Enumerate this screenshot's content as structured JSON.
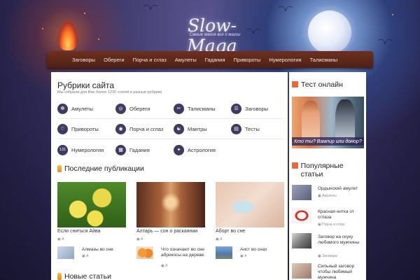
{
  "header": {
    "logo": "Slow-Maga",
    "slogan": "Самые магия все о магии"
  },
  "nav": {
    "items": [
      "Заговоры",
      "Обереги",
      "Порча и сглаз",
      "Амулеты",
      "Гадания",
      "Привороты",
      "Нумерология",
      "Талисманы"
    ]
  },
  "rubrics": {
    "title": "Рубрики сайта",
    "subtitle": "Мы собрали для Вас более 1230 статей в разные рубрики",
    "items": [
      {
        "label": "Амулеты",
        "icon": "amulet-icon",
        "glyph": "☸"
      },
      {
        "label": "Обереги",
        "icon": "ring-icon",
        "glyph": "◎"
      },
      {
        "label": "Талисманы",
        "icon": "talisman-icon",
        "glyph": "✂"
      },
      {
        "label": "Заговоры",
        "icon": "scroll-icon",
        "glyph": "☰"
      },
      {
        "label": "Привороты",
        "icon": "heart-icon",
        "glyph": "♡"
      },
      {
        "label": "Порча и сглаз",
        "icon": "eye-icon",
        "glyph": "◉"
      },
      {
        "label": "Мантры",
        "icon": "yin-yang-icon",
        "glyph": "☯"
      },
      {
        "label": "Тесты",
        "icon": "document-icon",
        "glyph": "▤"
      },
      {
        "label": "Нумерология",
        "icon": "number-icon",
        "glyph": "131"
      },
      {
        "label": "Гадания",
        "icon": "cards-icon",
        "glyph": "▦"
      },
      {
        "label": "Астрология",
        "icon": "star-icon",
        "glyph": "✦"
      }
    ]
  },
  "recent": {
    "title": "Последние публикации",
    "cards": [
      {
        "title": "Если сниться Айва",
        "meta": "А"
      },
      {
        "title": "Алтарь — сон о раскаянии",
        "meta": "А"
      },
      {
        "title": "Аборт во сне",
        "meta": "А"
      }
    ],
    "small": [
      {
        "title": "Алмазы во сне",
        "meta": "А"
      },
      {
        "title": "Что означают во сне абрикосы на дереве",
        "meta": "А"
      },
      {
        "title": "Аист во снах",
        "meta": "А"
      }
    ]
  },
  "new_section": {
    "title": "Новые статьи"
  },
  "sidebar": {
    "test_title": "Тест онлайн",
    "test_caption": "Кто ты? Вампир или донор?",
    "popular_title": "Популярные статьи",
    "popular": [
      {
        "title": "Ордынский амулет",
        "meta": "Амулеты"
      },
      {
        "title": "Красная нитка от сглаза",
        "meta": "Порча и сглаз"
      },
      {
        "title": "Заговор на скуку любимого мужчины",
        "meta": "Заговоры"
      },
      {
        "title": "Сильный заговор чтобы любимый мужчина",
        "meta": ""
      }
    ]
  },
  "colors": {
    "nav_bg": "#5a2618",
    "icon_bg": "#3f3a5f",
    "accent": "#e76a35"
  }
}
